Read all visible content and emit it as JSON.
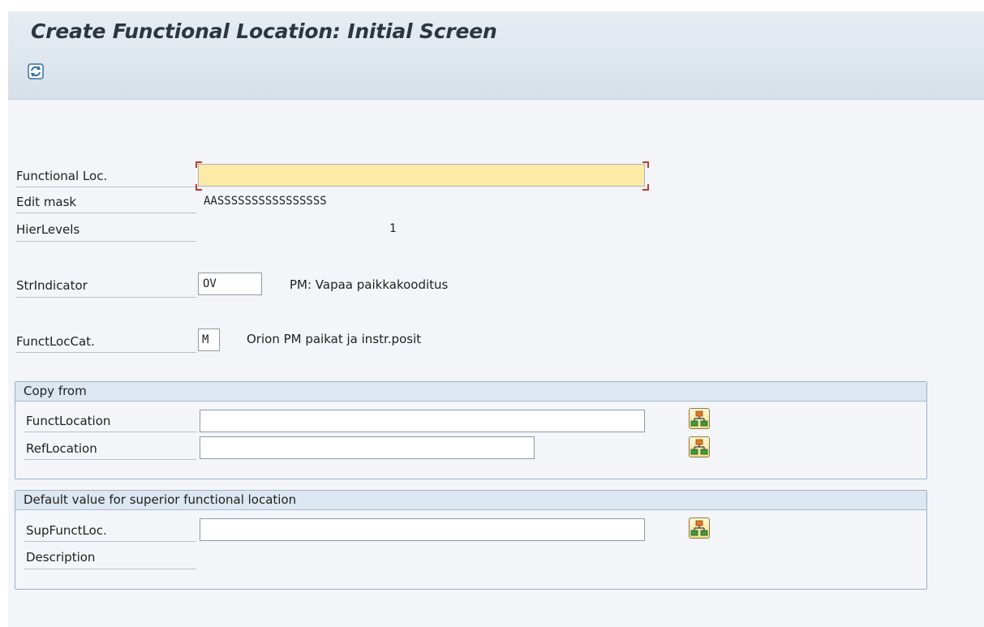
{
  "window": {
    "title": "Create Functional Location: Initial Screen"
  },
  "toolbar": {
    "refresh_icon": "refresh-icon"
  },
  "form": {
    "functional_loc_label": "Functional Loc.",
    "functional_loc_value": "",
    "edit_mask_label": "Edit mask",
    "edit_mask_value": "AASSSSSSSSSSSSSSSS",
    "hier_levels_label": "HierLevels",
    "hier_levels_value": "1",
    "str_indicator_label": "StrIndicator",
    "str_indicator_value": "OV",
    "str_indicator_desc": "PM: Vapaa paikkakooditus",
    "funct_loc_cat_label": "FunctLocCat.",
    "funct_loc_cat_value": "M",
    "funct_loc_cat_desc": "Orion PM paikat ja instr.posit"
  },
  "copy_from": {
    "title": "Copy from",
    "funct_location_label": "FunctLocation",
    "funct_location_value": "",
    "ref_location_label": "RefLocation",
    "ref_location_value": ""
  },
  "default_superior": {
    "title": "Default value for superior functional location",
    "sup_funct_loc_label": "SupFunctLoc.",
    "sup_funct_loc_value": "",
    "description_label": "Description"
  },
  "colors": {
    "title_bar": "#e3eaf1",
    "required_field": "#fdeaa6",
    "group_header": "#dde7f1",
    "hierarchy_button": "#f3dd92"
  }
}
